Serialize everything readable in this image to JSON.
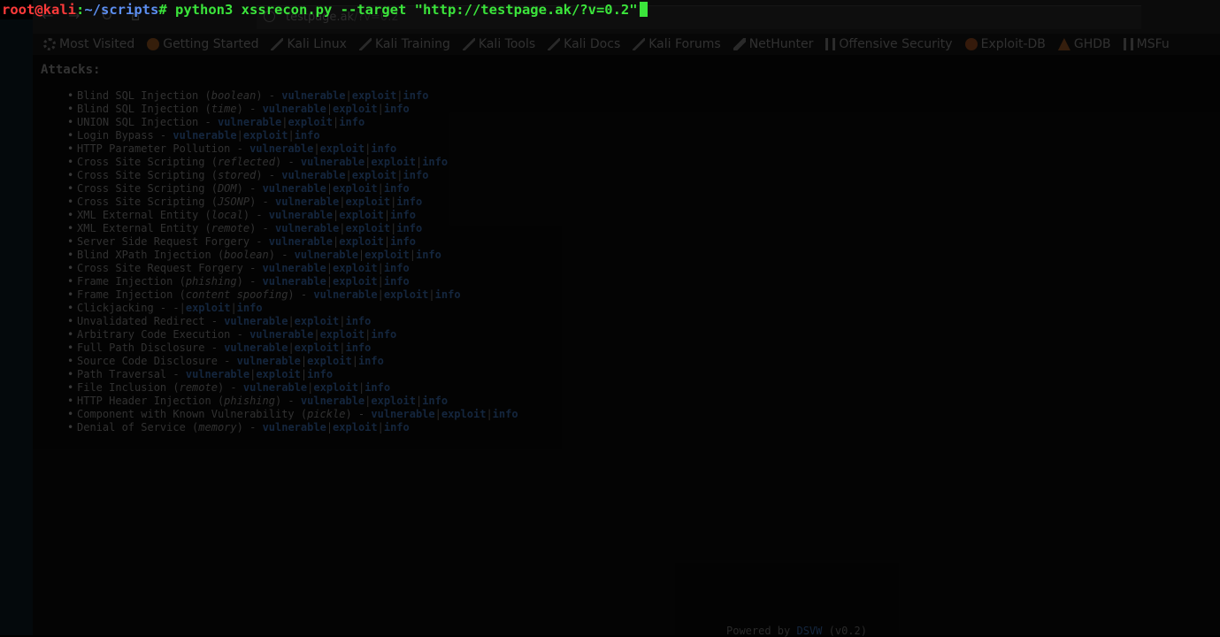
{
  "terminal": {
    "user_host": "root@kali",
    "colon": ":",
    "path": "~/scripts",
    "prompt_symbol": "#",
    "command": " python3 xssrecon.py --target \"http://testpage.ak/?v=0.2\""
  },
  "browser": {
    "nav_icons": [
      "back-arrow-icon",
      "forward-arrow-icon",
      "reload-icon",
      "home-icon"
    ],
    "url_host": "testpage.ak",
    "url_rest": "/?v=0.2",
    "bookmarks": [
      {
        "label": "Most Visited",
        "icon": "gear-icon"
      },
      {
        "label": "Getting Started",
        "icon": "firefox-icon"
      },
      {
        "label": "Kali Linux",
        "icon": "kali-dragon-icon"
      },
      {
        "label": "Kali Training",
        "icon": "kali-dragon-icon"
      },
      {
        "label": "Kali Tools",
        "icon": "kali-dragon-icon"
      },
      {
        "label": "Kali Docs",
        "icon": "kali-dragon-icon"
      },
      {
        "label": "Kali Forums",
        "icon": "kali-dragon-icon"
      },
      {
        "label": "NetHunter",
        "icon": "nethunter-icon"
      },
      {
        "label": "Offensive Security",
        "icon": "offsec-icon"
      },
      {
        "label": "Exploit-DB",
        "icon": "exploitdb-icon"
      },
      {
        "label": "GHDB",
        "icon": "ghdb-icon"
      },
      {
        "label": "MSFu",
        "icon": "offsec-icon"
      }
    ]
  },
  "page": {
    "title": "Attacks:",
    "link_labels": {
      "vulnerable": "vulnerable",
      "exploit": "exploit",
      "info": "info",
      "separator": "|",
      "dash": " - "
    },
    "attacks": [
      {
        "name": "Blind SQL Injection",
        "note": "boolean",
        "has_vulnerable": true
      },
      {
        "name": "Blind SQL Injection",
        "note": "time",
        "has_vulnerable": true
      },
      {
        "name": "UNION SQL Injection",
        "note": "",
        "has_vulnerable": true
      },
      {
        "name": "Login Bypass",
        "note": "",
        "has_vulnerable": true
      },
      {
        "name": "HTTP Parameter Pollution",
        "note": "",
        "has_vulnerable": true
      },
      {
        "name": "Cross Site Scripting",
        "note": "reflected",
        "has_vulnerable": true
      },
      {
        "name": "Cross Site Scripting",
        "note": "stored",
        "has_vulnerable": true
      },
      {
        "name": "Cross Site Scripting",
        "note": "DOM",
        "has_vulnerable": true
      },
      {
        "name": "Cross Site Scripting",
        "note": "JSONP",
        "has_vulnerable": true
      },
      {
        "name": "XML External Entity",
        "note": "local",
        "has_vulnerable": true
      },
      {
        "name": "XML External Entity",
        "note": "remote",
        "has_vulnerable": true
      },
      {
        "name": "Server Side Request Forgery",
        "note": "",
        "has_vulnerable": true
      },
      {
        "name": "Blind XPath Injection",
        "note": "boolean",
        "has_vulnerable": true
      },
      {
        "name": "Cross Site Request Forgery",
        "note": "",
        "has_vulnerable": true
      },
      {
        "name": "Frame Injection",
        "note": "phishing",
        "has_vulnerable": true
      },
      {
        "name": "Frame Injection",
        "note": "content spoofing",
        "has_vulnerable": true
      },
      {
        "name": "Clickjacking",
        "note": "",
        "has_vulnerable": false
      },
      {
        "name": "Unvalidated Redirect",
        "note": "",
        "has_vulnerable": true
      },
      {
        "name": "Arbitrary Code Execution",
        "note": "",
        "has_vulnerable": true
      },
      {
        "name": "Full Path Disclosure",
        "note": "",
        "has_vulnerable": true
      },
      {
        "name": "Source Code Disclosure",
        "note": "",
        "has_vulnerable": true
      },
      {
        "name": "Path Traversal",
        "note": "",
        "has_vulnerable": true
      },
      {
        "name": "File Inclusion",
        "note": "remote",
        "has_vulnerable": true
      },
      {
        "name": "HTTP Header Injection",
        "note": "phishing",
        "has_vulnerable": true
      },
      {
        "name": "Component with Known Vulnerability",
        "note": "pickle",
        "has_vulnerable": true
      },
      {
        "name": "Denial of Service",
        "note": "memory",
        "has_vulnerable": true
      }
    ],
    "footer": {
      "prefix": "Powered by ",
      "link": "DSVW",
      "version": " (v0.2)"
    }
  },
  "colors": {
    "prompt_user": "#ff3b3b",
    "prompt_path": "#5c8ef0",
    "command": "#3be43b",
    "link": "#1d3556",
    "page_text": "#454545",
    "background": "#000000"
  }
}
